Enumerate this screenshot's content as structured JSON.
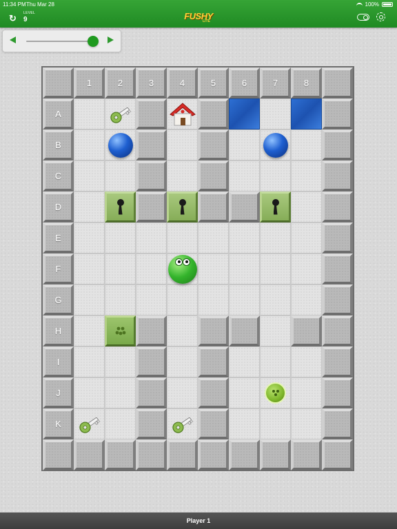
{
  "status": {
    "time": "11:34 PM",
    "date": "Thu Mar 28",
    "battery": "100%"
  },
  "header": {
    "level_caption": "LEVEL",
    "level_number": "9",
    "logo_text": "FUSHY",
    "logo_sub": "LITE",
    "restart_icon": "restart-icon",
    "toggle_icon": "toggle-icon",
    "settings_icon": "settings-icon"
  },
  "level_slider": {
    "position": 0.93
  },
  "board": {
    "columns": [
      "1",
      "2",
      "3",
      "4",
      "5",
      "6",
      "7",
      "8"
    ],
    "rows": [
      "A",
      "B",
      "C",
      "D",
      "E",
      "F",
      "G",
      "H",
      "I",
      "J",
      "K"
    ],
    "map": [
      "##########",
      "#..#.#W.W#",
      "#..#.#...#",
      "#..#.#...#",
      "#.L#L##L.#",
      "#........#",
      "#........#",
      "#........#",
      "#.S#.##.##",
      "#..#.#...#",
      "#..#.#...#",
      "#..#.#...#",
      "##########"
    ],
    "items": [
      {
        "kind": "key",
        "row": "A",
        "col": "2"
      },
      {
        "kind": "home",
        "row": "A",
        "col": "4"
      },
      {
        "kind": "ball",
        "row": "B",
        "col": "2"
      },
      {
        "kind": "ball",
        "row": "B",
        "col": "7"
      },
      {
        "kind": "player",
        "row": "F",
        "col": "4"
      },
      {
        "kind": "enemy",
        "row": "J",
        "col": "7"
      },
      {
        "kind": "key",
        "row": "K",
        "col": "1"
      },
      {
        "kind": "key",
        "row": "K",
        "col": "4"
      }
    ]
  },
  "footer": {
    "player_label": "Player 1"
  },
  "colors": {
    "header_green": "#2e9a2e",
    "ball_blue": "#1e5fd0",
    "player_green": "#34b42c",
    "water_blue": "#2d6fd3"
  }
}
